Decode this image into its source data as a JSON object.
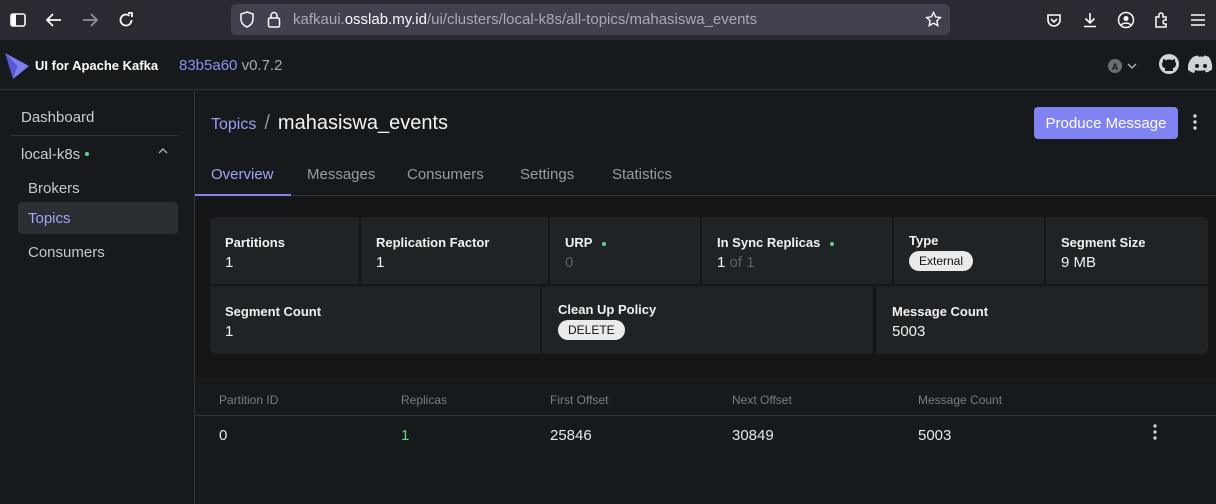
{
  "browser": {
    "url_host_prefix": "kafkaui.",
    "url_host": "osslab.my.id",
    "url_path": "/ui/clusters/local-k8s/all-topics/mahasiswa_events"
  },
  "app": {
    "name": "UI for Apache Kafka",
    "commit": "83b5a60",
    "version": "v0.7.2"
  },
  "sidebar": {
    "dashboard": "Dashboard",
    "cluster": "local-k8s",
    "items": [
      {
        "label": "Brokers"
      },
      {
        "label": "Topics"
      },
      {
        "label": "Consumers"
      }
    ]
  },
  "breadcrumb": {
    "parent": "Topics",
    "separator": "/",
    "title": "mahasiswa_events"
  },
  "actions": {
    "produce": "Produce Message"
  },
  "tabs": [
    "Overview",
    "Messages",
    "Consumers",
    "Settings",
    "Statistics"
  ],
  "stats": {
    "partitions": {
      "label": "Partitions",
      "value": "1"
    },
    "replication_factor": {
      "label": "Replication Factor",
      "value": "1"
    },
    "urp": {
      "label": "URP",
      "value": "0"
    },
    "in_sync": {
      "label": "In Sync Replicas",
      "value": "1",
      "of": "of 1"
    },
    "type": {
      "label": "Type",
      "value": "External"
    },
    "segment_size": {
      "label": "Segment Size",
      "value": "9 MB"
    },
    "segment_count": {
      "label": "Segment Count",
      "value": "1"
    },
    "cleanup": {
      "label": "Clean Up Policy",
      "value": "DELETE"
    },
    "message_count": {
      "label": "Message Count",
      "value": "5003"
    }
  },
  "table": {
    "headers": [
      "Partition ID",
      "Replicas",
      "First Offset",
      "Next Offset",
      "Message Count"
    ],
    "rows": [
      [
        "0",
        "1",
        "25846",
        "30849",
        "5003"
      ]
    ]
  }
}
